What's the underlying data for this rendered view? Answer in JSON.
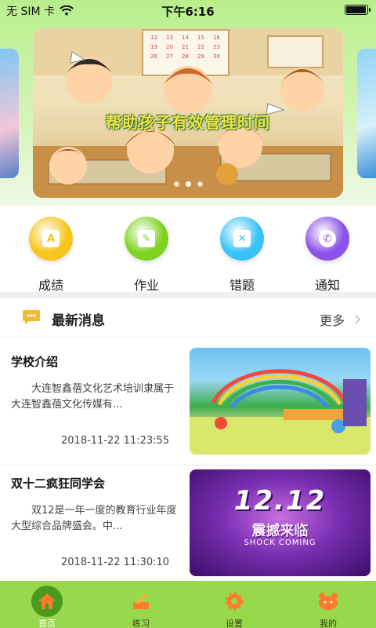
{
  "status_bar": {
    "carrier": "无 SIM 卡",
    "time": "下午6:16",
    "battery_level": 0.95
  },
  "banner": {
    "caption": "帮助孩子有效管理时间",
    "calendar_numbers": [
      "12",
      "13",
      "14",
      "15",
      "16",
      "19",
      "20",
      "21",
      "22",
      "23",
      "26",
      "27",
      "28",
      "29",
      "30"
    ],
    "slide_count": 3,
    "active_slide": 2
  },
  "features": [
    {
      "label": "成绩",
      "icon": "grade-a-icon",
      "color": "#f6c51a",
      "glyph": "A"
    },
    {
      "label": "作业",
      "icon": "pencil-icon",
      "color": "#7ed321",
      "glyph": "✎"
    },
    {
      "label": "错题",
      "icon": "wrong-question-icon",
      "color": "#38c3f5",
      "glyph": "✕"
    },
    {
      "label": "通知",
      "icon": "phone-icon",
      "color": "#8a52e8",
      "glyph": "✆"
    }
  ],
  "news": {
    "title": "最新消息",
    "more": "更多",
    "items": [
      {
        "title": "学校介绍",
        "summary": "大连智鑫蓓文化艺术培训隶属于大连智鑫蓓文化传媒有...",
        "date": "2018-11-22 11:23:55",
        "thumb": "classroom-photo"
      },
      {
        "title": "双十二疯狂同学会",
        "summary": "双12是一年一度的教育行业年度大型综合品牌盛会。中...",
        "date": "2018-11-22 11:30:10",
        "thumb": "promo-1212",
        "thumb_text": "12.12",
        "thumb_sub": "震撼来临",
        "thumb_en": "SHOCK COMING"
      }
    ]
  },
  "tabs": [
    {
      "label": "首页",
      "icon": "home-icon",
      "active": true
    },
    {
      "label": "练习",
      "icon": "pencil-paper-icon",
      "active": false
    },
    {
      "label": "设置",
      "icon": "gear-icon",
      "active": false
    },
    {
      "label": "我的",
      "icon": "face-icon",
      "active": false
    }
  ],
  "colors": {
    "tabbar": "#98d84d",
    "tab_active": "#4a9a1f",
    "header_gradient_top": "#b8ef8c",
    "chat_icon": "#f5b933"
  }
}
